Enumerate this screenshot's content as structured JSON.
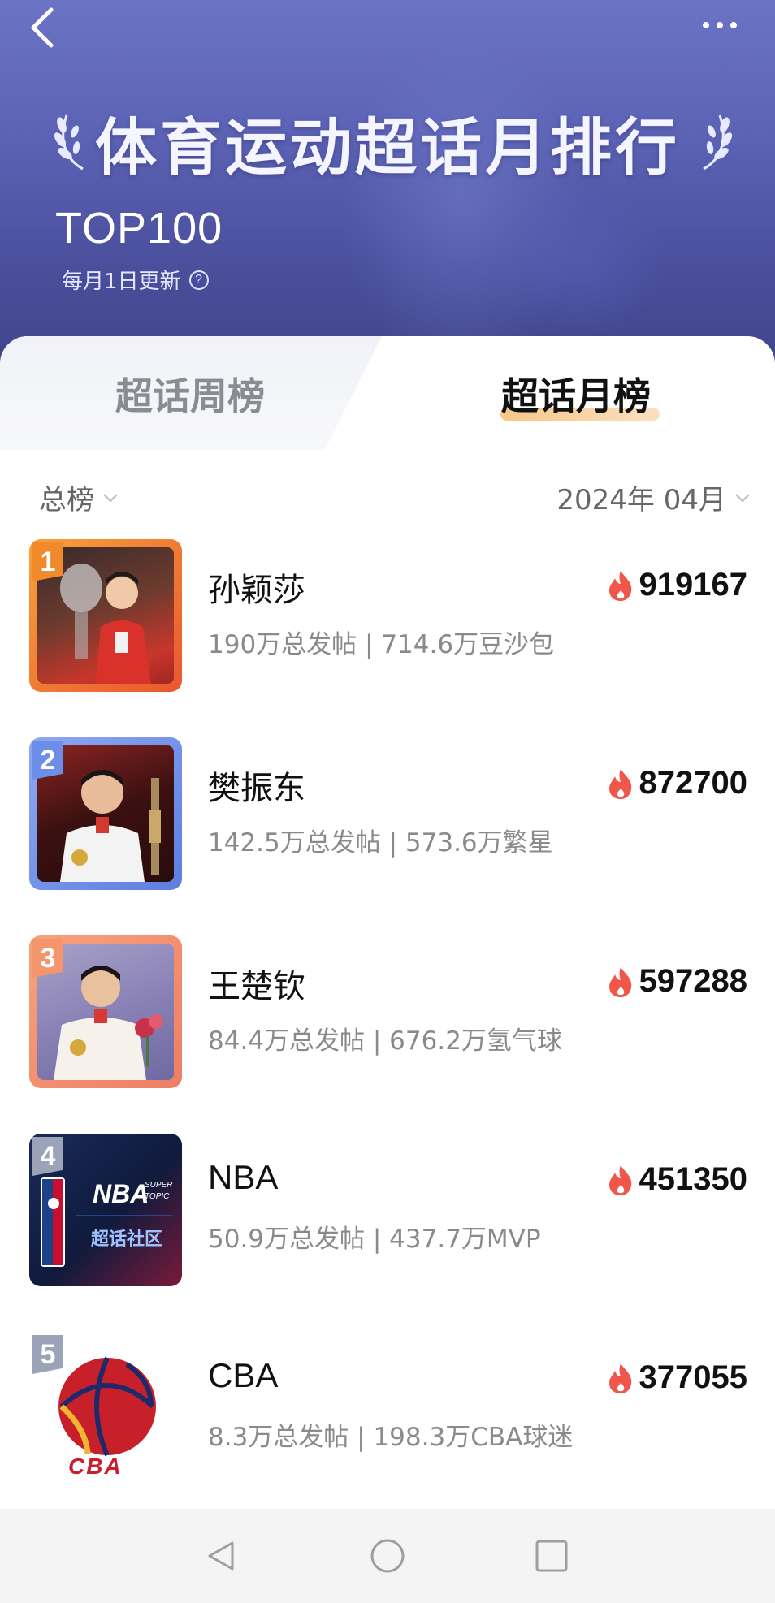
{
  "header": {
    "title": "体育运动超话月排行",
    "subtitle": "TOP100",
    "update_note": "每月1日更新",
    "help_icon": "?"
  },
  "tabs": [
    {
      "label": "超话周榜",
      "active": false
    },
    {
      "label": "超话月榜",
      "active": true
    }
  ],
  "filters": {
    "category": "总榜",
    "period": "2024年 04月"
  },
  "items": [
    {
      "rank": "1",
      "name": "孙颖莎",
      "stats": "190万总发帖 | 714.6万豆沙包",
      "heat": "919167",
      "badge_color": "#f08a2a"
    },
    {
      "rank": "2",
      "name": "樊振东",
      "stats": "142.5万总发帖 | 573.6万繁星",
      "heat": "872700",
      "badge_color": "#6d8ee8"
    },
    {
      "rank": "3",
      "name": "王楚钦",
      "stats": "84.4万总发帖 | 676.2万氢气球",
      "heat": "597288",
      "badge_color": "#f4956b"
    },
    {
      "rank": "4",
      "name": "NBA",
      "stats": "50.9万总发帖 | 437.7万MVP",
      "heat": "451350",
      "badge_color": "#9aa3b8"
    },
    {
      "rank": "5",
      "name": "CBA",
      "stats": "8.3万总发帖 | 198.3万CBA球迷",
      "heat": "377055",
      "badge_color": "#9aa3b8"
    }
  ],
  "thumb_text": {
    "nba_logo": "NBA",
    "nba_super": "SUPER",
    "nba_topic": "TOPIC",
    "nba_community": "超话社区",
    "cba_logo": "CBA"
  },
  "colors": {
    "header": "#5c63b5",
    "flame": "#f0564a",
    "tab_underline": "#f6b96a"
  },
  "icons": {
    "back": "chevron-left-icon",
    "more": "more-dots-icon",
    "heat": "flame-icon",
    "dropdown": "chevron-down-icon",
    "nav_back": "triangle-back-icon",
    "nav_home": "circle-home-icon",
    "nav_recent": "square-recent-icon"
  }
}
